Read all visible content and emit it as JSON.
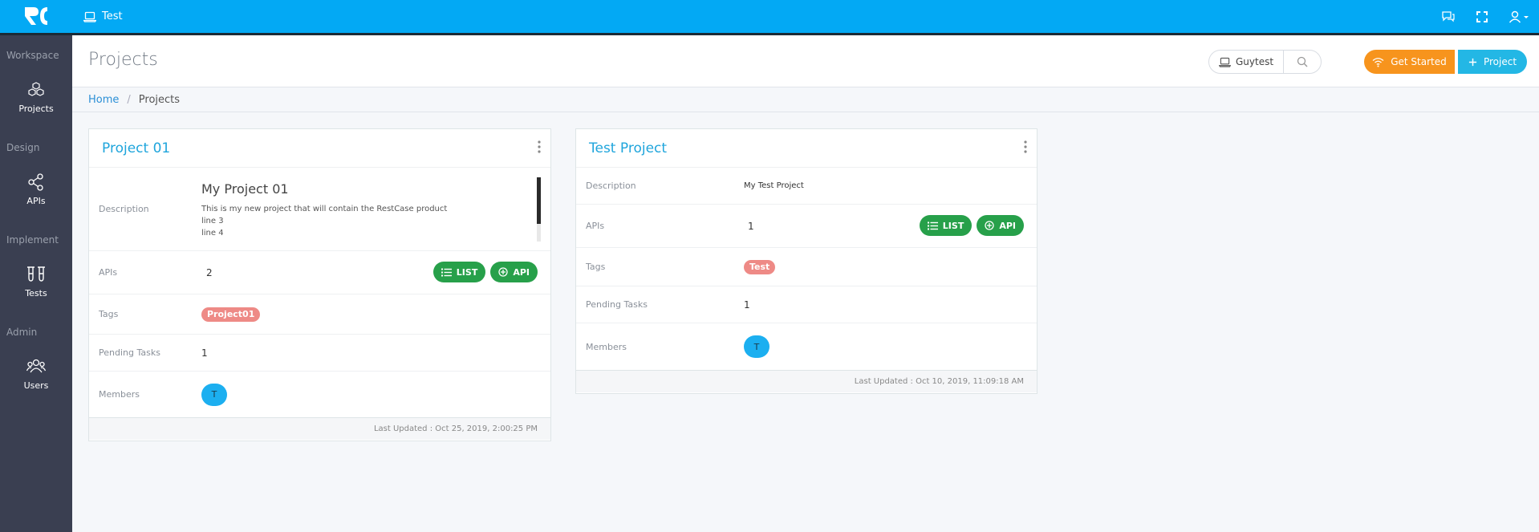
{
  "topbar": {
    "workspace_label": "Test"
  },
  "sidebar": {
    "sections": [
      {
        "title": "Workspace",
        "item": "Projects"
      },
      {
        "title": "Design",
        "item": "APIs"
      },
      {
        "title": "Implement",
        "item": "Tests"
      },
      {
        "title": "Admin",
        "item": "Users"
      }
    ]
  },
  "header": {
    "title": "Projects",
    "workspace_button": "Guytest",
    "get_started": "Get Started",
    "add_project": "Project"
  },
  "breadcrumb": {
    "home": "Home",
    "separator": "/",
    "current": "Projects"
  },
  "labels": {
    "description": "Description",
    "apis": "APIs",
    "tags": "Tags",
    "pending_tasks": "Pending Tasks",
    "members": "Members",
    "list_button": "LIST",
    "api_button": "API"
  },
  "projects": [
    {
      "title": "Project 01",
      "description_title": "My Project 01",
      "description_lines": [
        "This is my new project that will contain the RestCase product",
        "line 3",
        "line 4"
      ],
      "apis_count": "2",
      "tag": "Project01",
      "pending_tasks": "1",
      "member_initial": "T",
      "last_updated": "Last Updated : Oct 25, 2019, 2:00:25 PM"
    },
    {
      "title": "Test Project",
      "description": "My Test Project",
      "apis_count": "1",
      "tag": "Test",
      "pending_tasks": "1",
      "member_initial": "T",
      "last_updated": "Last Updated : Oct 10, 2019, 11:09:18 AM"
    }
  ],
  "colors": {
    "topbar": "#03a9f4",
    "sidebar": "#3a3f51",
    "accent_green": "#27a04a",
    "accent_orange": "#f7941d",
    "accent_blue": "#23b7e5",
    "tag": "#ee8a86"
  }
}
